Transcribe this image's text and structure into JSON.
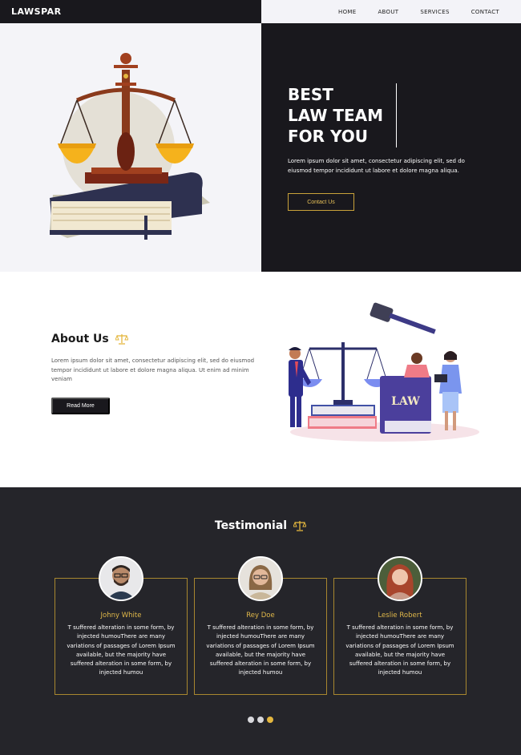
{
  "header": {
    "logo": "LAWSPAR",
    "nav": [
      {
        "label": "HOME"
      },
      {
        "label": "ABOUT"
      },
      {
        "label": "SERVICES"
      },
      {
        "label": "CONTACT"
      }
    ]
  },
  "hero": {
    "title_lines": [
      "BEST",
      "LAW TEAM",
      "FOR YOU"
    ],
    "text": "Lorem ipsum dolor sit amet, consectetur adipiscing elit, sed do eiusmod tempor incididunt ut labore et dolore magna aliqua.",
    "button_label": "Contact Us"
  },
  "about": {
    "title": "About Us",
    "text": "Lorem ipsum dolor sit amet, consectetur adipiscing elit, sed do eiusmod tempor incididunt ut labore et dolore magna aliqua. Ut enim ad minim veniam",
    "button_label": "Read More",
    "book_label": "LAW"
  },
  "testimonial": {
    "title": "Testimonial",
    "cards": [
      {
        "name": "Johny White",
        "text": "T suffered alteration in some form, by injected humouThere are many variations of passages of Lorem Ipsum available, but the majority have suffered alteration in some form, by injected humou"
      },
      {
        "name": "Rey Doe",
        "text": "T suffered alteration in some form, by injected humouThere are many variations of passages of Lorem Ipsum available, but the majority have suffered alteration in some form, by injected humou"
      },
      {
        "name": "Leslie Robert",
        "text": "T suffered alteration in some form, by injected humouThere are many variations of passages of Lorem Ipsum available, but the majority have suffered alteration in some form, by injected humou"
      }
    ],
    "dots_active_index": 2
  },
  "colors": {
    "dark": "#19181d",
    "accent_gold": "#e4b73f",
    "light_bg": "#f4f4f8",
    "testimonial_bg": "#25252a"
  }
}
